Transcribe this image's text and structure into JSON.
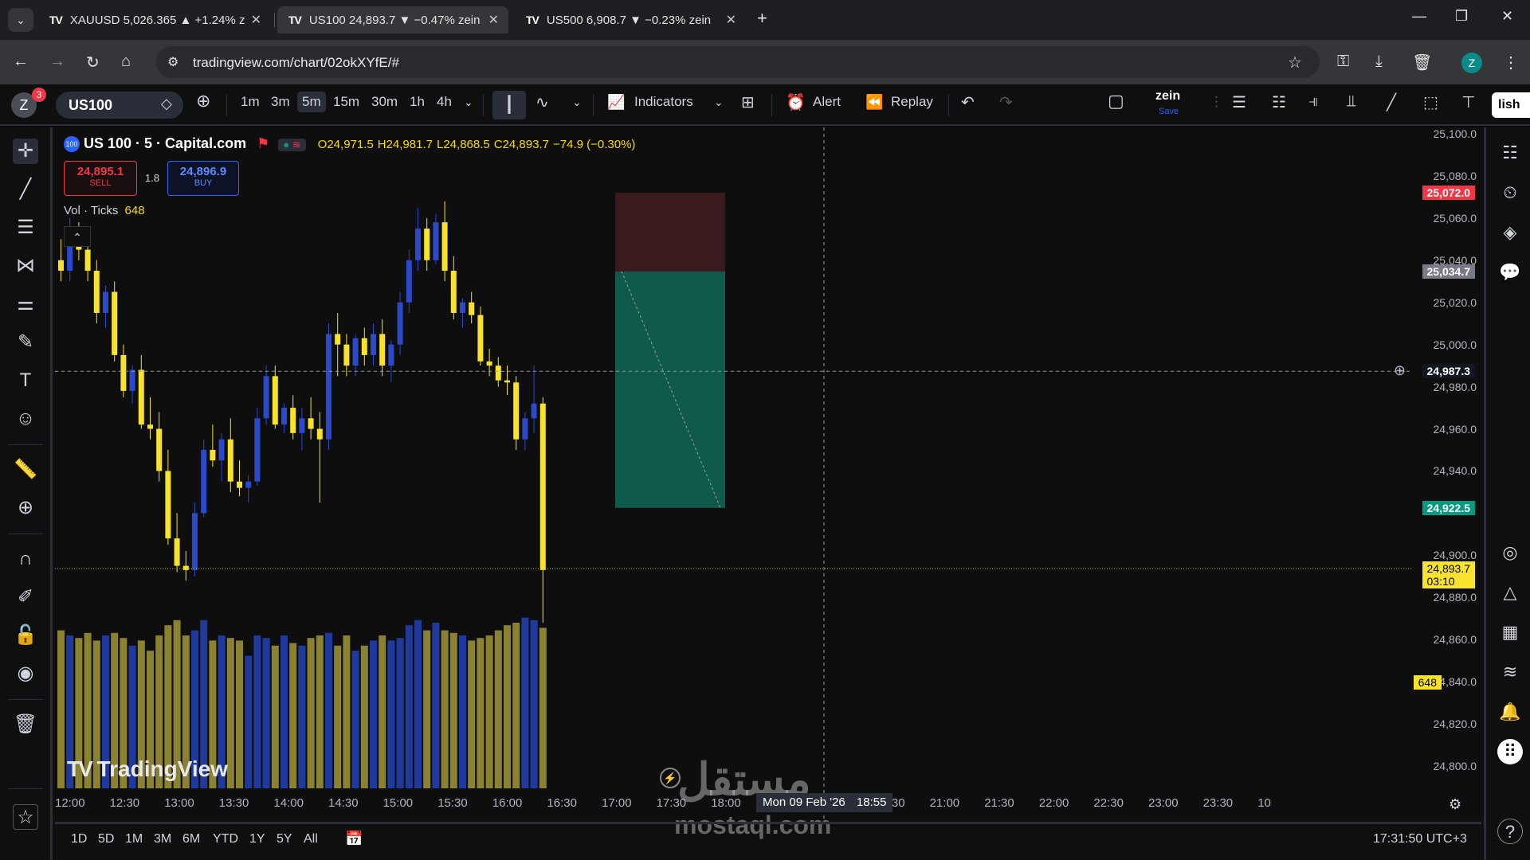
{
  "browser": {
    "tabs": [
      {
        "title": "XAUUSD 5,026.365 ▲ +1.24% z",
        "active": false
      },
      {
        "title": "US100 24,893.7 ▼ −0.47% zein",
        "active": true
      },
      {
        "title": "US500 6,908.7 ▼ −0.23% zein",
        "active": false
      }
    ],
    "url": "tradingview.com/chart/02okXYfE/#",
    "profile_initial": "Z"
  },
  "toolbar": {
    "avatar_initial": "Z",
    "notification_count": "3",
    "symbol": "US100",
    "intervals": [
      "1m",
      "3m",
      "5m",
      "15m",
      "30m",
      "1h",
      "4h"
    ],
    "selected_interval": "5m",
    "indicators_label": "Indicators",
    "alert_label": "Alert",
    "replay_label": "Replay",
    "layout_name": "zein",
    "save_label": "Save",
    "publish_label": "lish"
  },
  "legend": {
    "title": "US 100 · 5 · Capital.com",
    "open": "O24,971.5",
    "high": "H24,981.7",
    "low": "L24,868.5",
    "close": "C24,893.7",
    "change": "−74.9 (−0.30%)",
    "sell_price": "24,895.1",
    "sell_label": "SELL",
    "spread": "1.8",
    "buy_price": "24,896.9",
    "buy_label": "BUY",
    "vol_label": "Vol · Ticks",
    "vol_value": "648",
    "badge": "100"
  },
  "price_axis": {
    "labels": [
      "25,100.0",
      "25,080.0",
      "25,060.0",
      "25,040.0",
      "25,020.0",
      "25,000.0",
      "24,980.0",
      "24,960.0",
      "24,940.0",
      "24,900.0",
      "24,880.0",
      "24,860.0",
      "24,840.0",
      "24,820.0",
      "24,800.0"
    ],
    "tags": {
      "stop": "25,072.0",
      "entry": "25,034.7",
      "crosshair": "24,987.3",
      "target": "24,922.5",
      "last": "24,893.7",
      "countdown": "03:10",
      "volume": "648"
    }
  },
  "time_axis": {
    "labels": [
      "12:00",
      "12:30",
      "13:00",
      "13:30",
      "14:00",
      "14:30",
      "15:00",
      "15:30",
      "16:00",
      "16:30",
      "17:00",
      "17:30",
      "18:00",
      "30",
      "20:00",
      "20:30",
      "21:00",
      "21:30",
      "22:00",
      "22:30",
      "23:00",
      "23:30",
      "10"
    ],
    "crosshair_date": "Mon 09 Feb '26",
    "crosshair_time": "18:55"
  },
  "bottom": {
    "ranges": [
      "1D",
      "5D",
      "1M",
      "3M",
      "6M",
      "YTD",
      "1Y",
      "5Y",
      "All"
    ],
    "clock": "17:31:50 UTC+3"
  },
  "watermark": {
    "brand": "TradingView",
    "site_ar": "مستقل",
    "site": "mostaql.com"
  },
  "colors": {
    "up": "#2b4acb",
    "down": "#f7e22e",
    "vol_up": "#1f3a9c",
    "vol_down": "#8a8230",
    "stop_zone": "#3a1a1c",
    "target_zone": "#0f5a4a",
    "accent_red": "#f23645",
    "accent_green": "#089981"
  },
  "chart_data": {
    "type": "candlestick",
    "symbol": "US100",
    "interval": "5",
    "candles": [
      [
        25040,
        25050,
        25030,
        25035
      ],
      [
        25035,
        25060,
        25030,
        25050
      ],
      [
        25050,
        25058,
        25040,
        25045
      ],
      [
        25045,
        25052,
        25030,
        25035
      ],
      [
        25035,
        25040,
        25010,
        25015
      ],
      [
        25015,
        25028,
        25008,
        25025
      ],
      [
        25025,
        25030,
        24992,
        24995
      ],
      [
        24995,
        25000,
        24975,
        24978
      ],
      [
        24978,
        24990,
        24972,
        24988
      ],
      [
        24988,
        24995,
        24960,
        24962
      ],
      [
        24962,
        24975,
        24955,
        24960
      ],
      [
        24960,
        24968,
        24935,
        24940
      ],
      [
        24940,
        24950,
        24905,
        24908
      ],
      [
        24908,
        24920,
        24892,
        24895
      ],
      [
        24895,
        24902,
        24888,
        24893
      ],
      [
        24893,
        24925,
        24890,
        24920
      ],
      [
        24920,
        24955,
        24918,
        24950
      ],
      [
        24950,
        24962,
        24942,
        24945
      ],
      [
        24945,
        24958,
        24935,
        24955
      ],
      [
        24955,
        24965,
        24930,
        24935
      ],
      [
        24935,
        24945,
        24928,
        24932
      ],
      [
        24932,
        24938,
        24925,
        24935
      ],
      [
        24935,
        24970,
        24933,
        24965
      ],
      [
        24965,
        24990,
        24962,
        24985
      ],
      [
        24985,
        24990,
        24960,
        24962
      ],
      [
        24962,
        24972,
        24958,
        24970
      ],
      [
        24970,
        24976,
        24955,
        24958
      ],
      [
        24958,
        24970,
        24950,
        24965
      ],
      [
        24965,
        24975,
        24955,
        24960
      ],
      [
        24960,
        24968,
        24925,
        24955
      ],
      [
        24955,
        25010,
        24950,
        25005
      ],
      [
        25005,
        25015,
        24985,
        25000
      ],
      [
        25000,
        25005,
        24985,
        24990
      ],
      [
        24990,
        25005,
        24985,
        25003
      ],
      [
        25003,
        25008,
        24990,
        24995
      ],
      [
        24995,
        25010,
        24990,
        25005
      ],
      [
        25005,
        25012,
        24985,
        24990
      ],
      [
        24990,
        25002,
        24982,
        25000
      ],
      [
        25000,
        25025,
        24995,
        25020
      ],
      [
        25020,
        25045,
        25015,
        25040
      ],
      [
        25040,
        25065,
        25035,
        25055
      ],
      [
        25055,
        25060,
        25035,
        25040
      ],
      [
        25040,
        25062,
        25038,
        25058
      ],
      [
        25058,
        25068,
        25030,
        25035
      ],
      [
        25035,
        25042,
        25012,
        25015
      ],
      [
        25015,
        25022,
        25008,
        25020
      ],
      [
        25020,
        25025,
        25010,
        25014
      ],
      [
        25014,
        25018,
        24990,
        24992
      ],
      [
        24992,
        24998,
        24985,
        24990
      ],
      [
        24990,
        24994,
        24980,
        24983
      ],
      [
        24983,
        24990,
        24976,
        24982
      ],
      [
        24982,
        24985,
        24950,
        24955
      ],
      [
        24955,
        24968,
        24950,
        24965
      ],
      [
        24965,
        24990,
        24958,
        24972
      ],
      [
        24972,
        24975,
        24868,
        24893
      ]
    ],
    "volume": [
      620,
      600,
      590,
      610,
      580,
      600,
      610,
      590,
      560,
      580,
      540,
      600,
      640,
      660,
      600,
      620,
      660,
      580,
      600,
      590,
      580,
      520,
      600,
      590,
      560,
      600,
      570,
      560,
      590,
      600,
      610,
      560,
      600,
      540,
      560,
      580,
      600,
      580,
      590,
      640,
      660,
      620,
      650,
      620,
      610,
      600,
      580,
      590,
      600,
      620,
      640,
      650,
      670,
      660,
      630
    ]
  }
}
